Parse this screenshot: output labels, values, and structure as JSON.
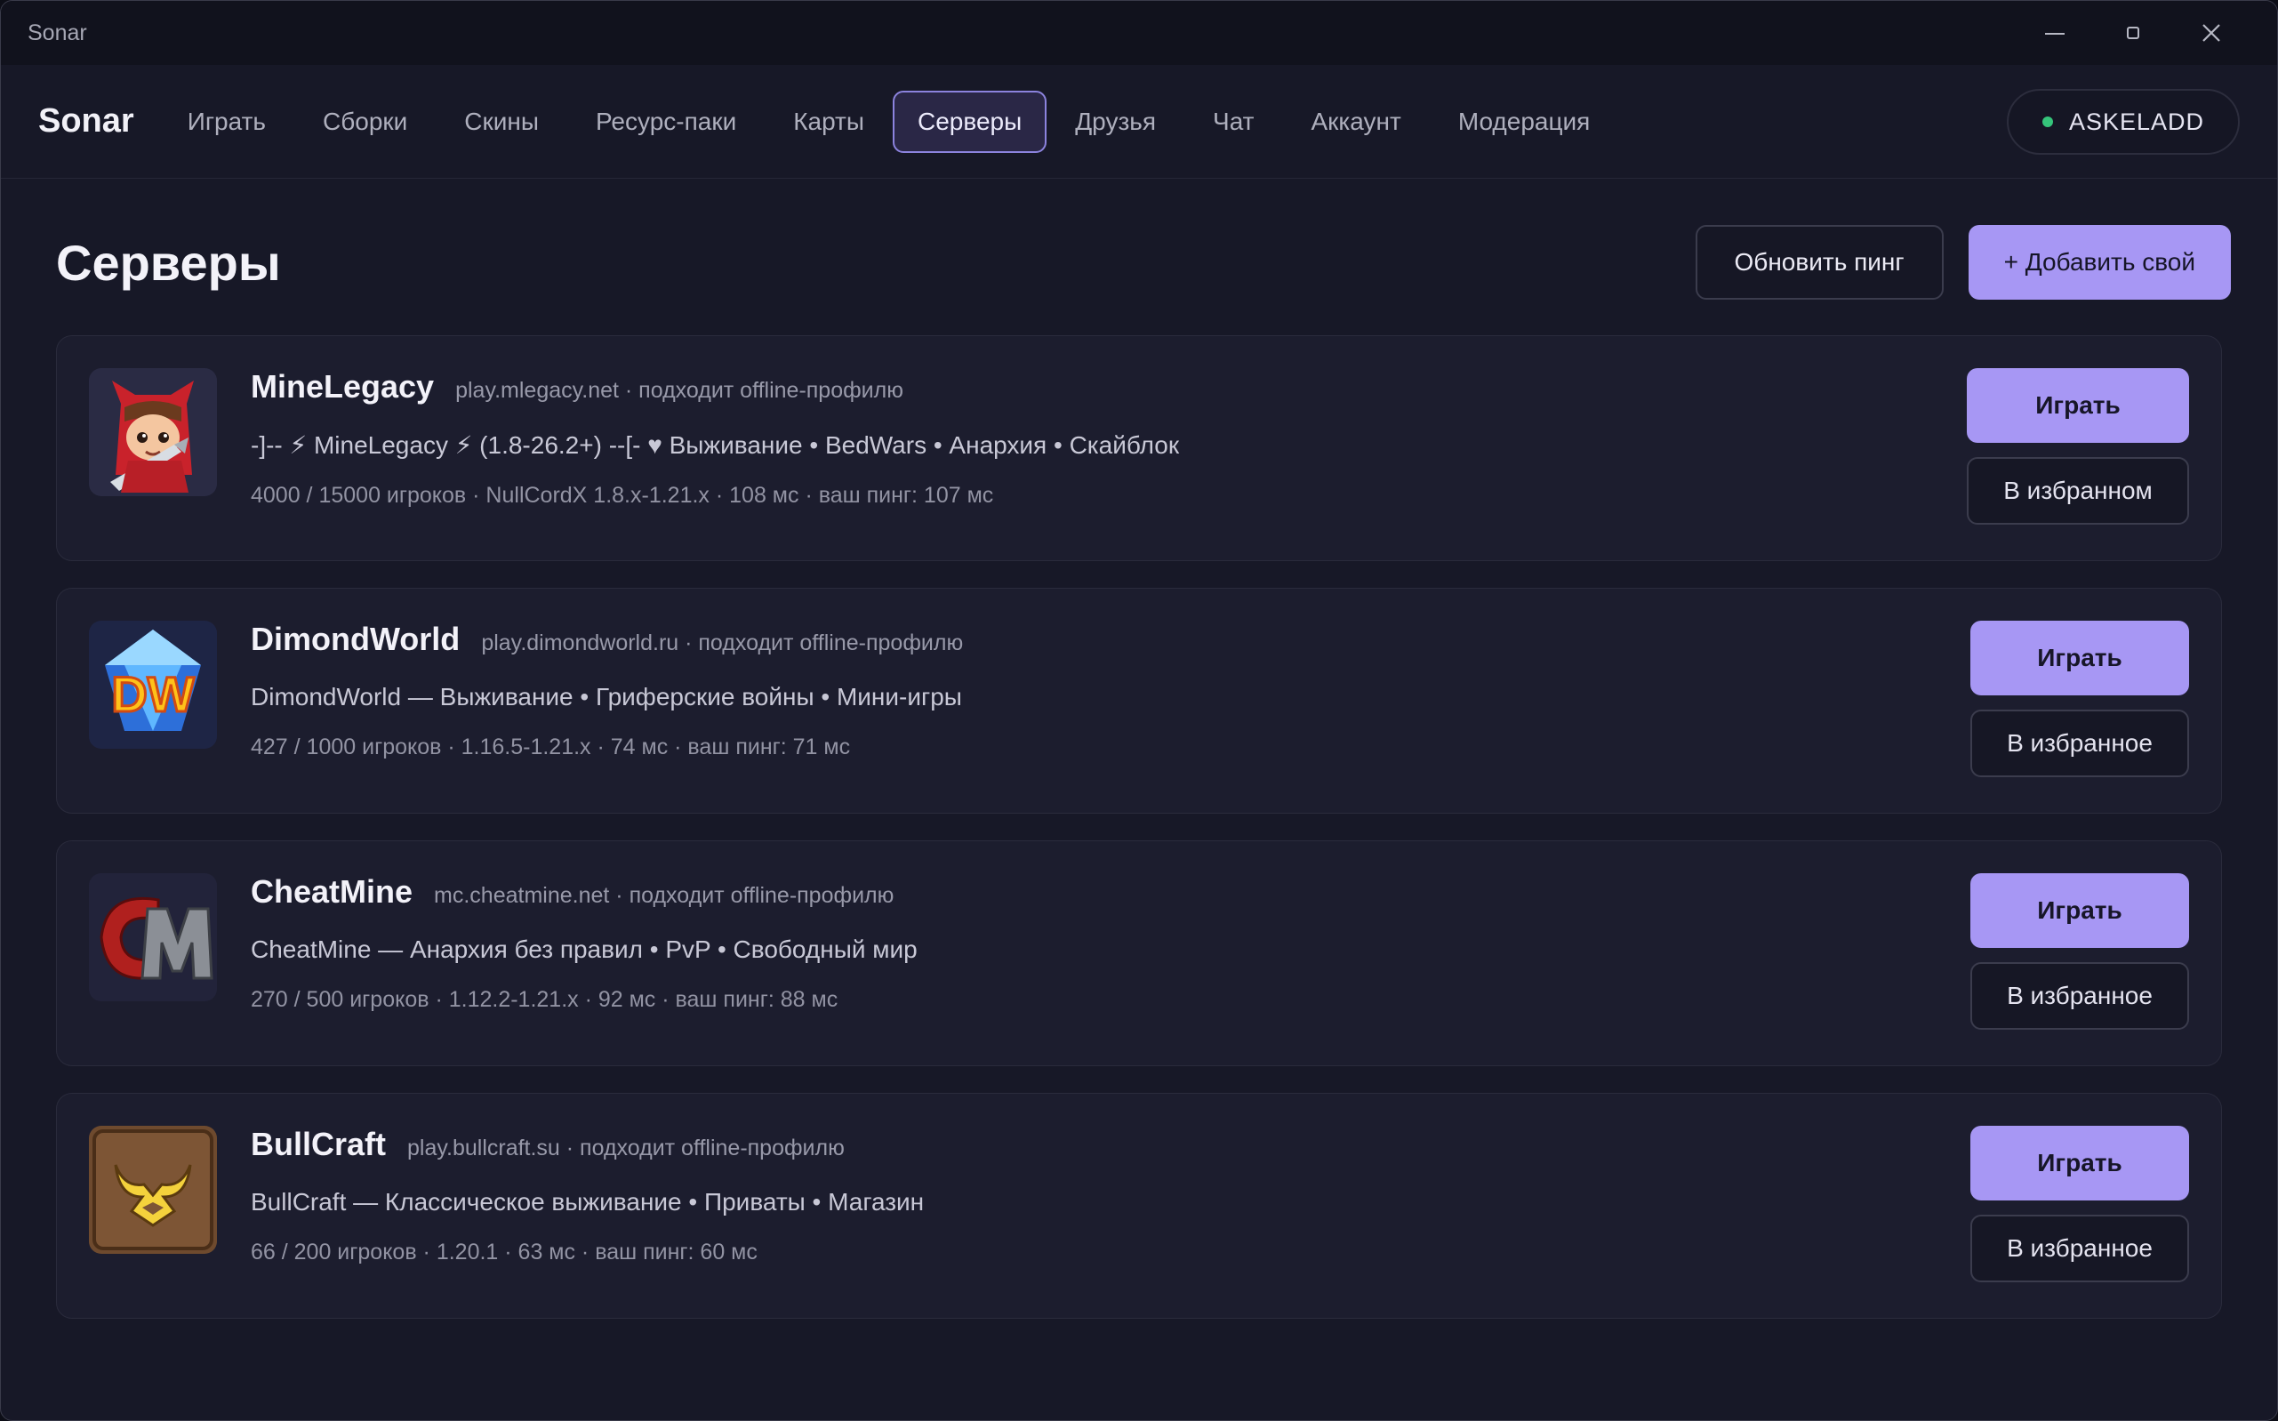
{
  "window": {
    "title": "Sonar"
  },
  "nav": {
    "brand": "Sonar",
    "items": [
      {
        "label": "Играть"
      },
      {
        "label": "Сборки"
      },
      {
        "label": "Скины"
      },
      {
        "label": "Ресурс-паки"
      },
      {
        "label": "Карты"
      },
      {
        "label": "Серверы",
        "active": true
      },
      {
        "label": "Друзья"
      },
      {
        "label": "Чат"
      },
      {
        "label": "Аккаунт"
      },
      {
        "label": "Модерация"
      }
    ],
    "account": {
      "name": "ASKELADD",
      "status_color": "#35c47a"
    }
  },
  "page": {
    "title": "Серверы",
    "refresh_label": "Обновить пинг",
    "add_label": "+ Добавить свой"
  },
  "servers": [
    {
      "name": "MineLegacy",
      "address": "play.mlegacy.net · подходит offline-профилю",
      "motd": "-]-- ⚡ MineLegacy ⚡ (1.8-26.2+) --[- ♥ Выживание • BedWars • Анархия • Скайблок",
      "stats": "4000 / 15000 игроков · NullCordX 1.8.x-1.21.x · 108 мс · ваш пинг: 107 мс",
      "play_label": "Играть",
      "fav_label": "В избранном",
      "logo_icon": "red-hood-character-icon"
    },
    {
      "name": "DimondWorld",
      "address": "play.dimondworld.ru · подходит offline-профилю",
      "motd": "DimondWorld — Выживание • Гриферские войны • Мини-игры",
      "stats": "427 / 1000 игроков · 1.16.5-1.21.x · 74 мс · ваш пинг: 71 мс",
      "play_label": "Играть",
      "fav_label": "В избранное",
      "logo_icon": "dw-diamond-logo-icon"
    },
    {
      "name": "CheatMine",
      "address": "mc.cheatmine.net · подходит offline-профилю",
      "motd": "CheatMine — Анархия без правил • PvP • Свободный мир",
      "stats": "270 / 500 игроков · 1.12.2-1.21.x · 92 мс · ваш пинг: 88 мс",
      "play_label": "Играть",
      "fav_label": "В избранное",
      "logo_icon": "cm-letters-logo-icon"
    },
    {
      "name": "BullCraft",
      "address": "play.bullcraft.su · подходит offline-профилю",
      "motd": "BullCraft — Классическое выживание • Приваты • Магазин",
      "stats": "66 / 200 игроков · 1.20.1 · 63 мс · ваш пинг: 60 мс",
      "play_label": "Играть",
      "fav_label": "В избранное",
      "logo_icon": "bull-horns-logo-icon"
    }
  ],
  "colors": {
    "accent": "#a797f4",
    "background": "#171827",
    "card": "#1c1d2e"
  }
}
